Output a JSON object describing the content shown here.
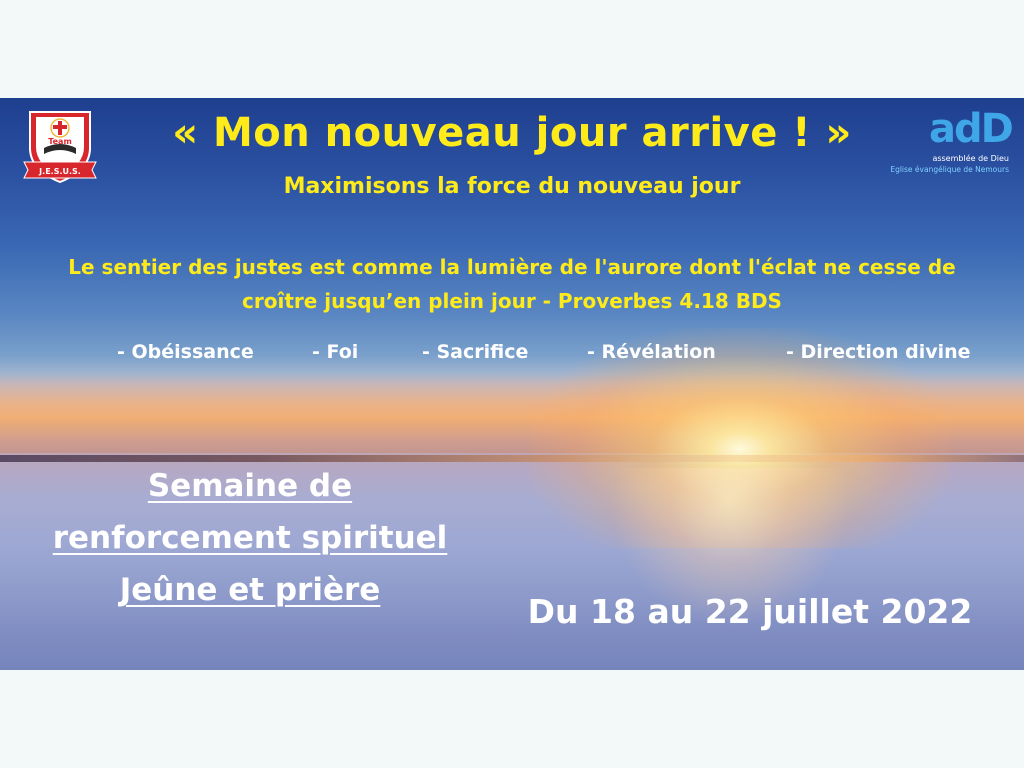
{
  "banner": {
    "title": "« Mon nouveau jour arrive ! »",
    "subtitle": "Maximisons la force du nouveau jour",
    "verse_line1": "Le sentier des justes est comme la lumière de l'aurore dont l'éclat ne cesse de",
    "verse_line2": "croître jusqu’en plein jour - Proverbes 4.18 BDS",
    "themes": [
      "- Obéissance",
      "- Foi",
      "- Sacrifice",
      "- Révélation",
      "- Direction divine"
    ],
    "event_line1": "Semaine de",
    "event_line2": "renforcement spirituel",
    "event_line3": "Jeûne et prière",
    "dates": "Du 18 au 22 juillet 2022"
  },
  "logos": {
    "left_badge_text": "Team",
    "left_ribbon_text": "J.E.S.U.S.",
    "right_mark": "adD",
    "right_line1": "assemblée de Dieu",
    "right_line2": "Eglise évangélique de Nemours"
  },
  "colors": {
    "title_yellow": "#ffeb1a",
    "text_white": "#ffffff",
    "logo_blue": "#3fa6e8",
    "badge_red": "#d8262d"
  }
}
